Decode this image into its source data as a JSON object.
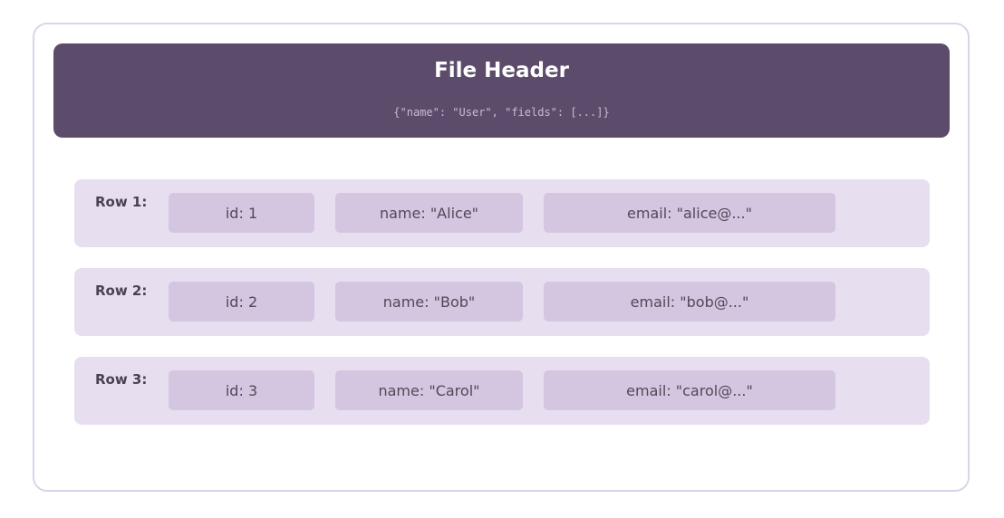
{
  "header": {
    "title": "File Header",
    "schema": "{\"name\": \"User\", \"fields\": [...]}"
  },
  "rows": [
    {
      "label": "Row 1:",
      "id": "id: 1",
      "name": "name: \"Alice\"",
      "email": "email: \"alice@...\""
    },
    {
      "label": "Row 2:",
      "id": "id: 2",
      "name": "name: \"Bob\"",
      "email": "email: \"bob@...\""
    },
    {
      "label": "Row 3:",
      "id": "id: 3",
      "name": "name: \"Carol\"",
      "email": "email: \"carol@...\""
    }
  ],
  "colors": {
    "header_bg": "#5c4b6b",
    "row_bg": "#e7dff0",
    "cell_bg": "#d4c5e1",
    "frame_border": "#ddd3e8"
  }
}
